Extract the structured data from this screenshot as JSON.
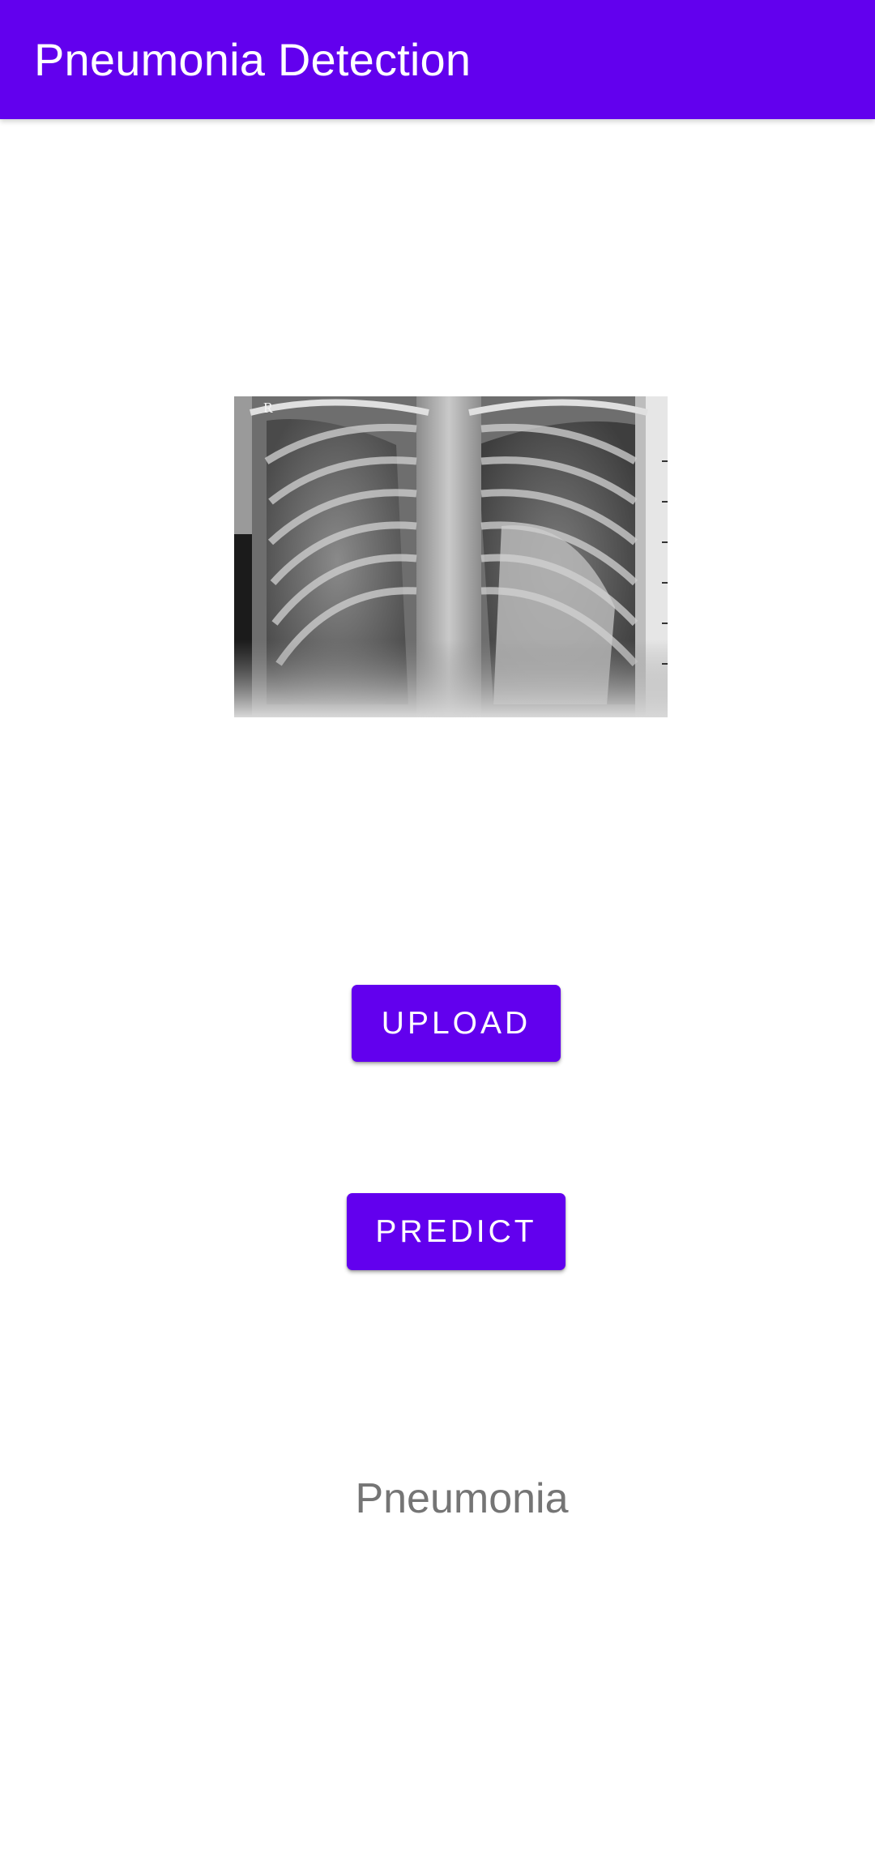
{
  "app_bar": {
    "title": "Pneumonia Detection",
    "color": "#6200ee"
  },
  "preview": {
    "marker_letter": "R"
  },
  "buttons": {
    "upload_label": "UPLOAD",
    "predict_label": "PREDICT"
  },
  "result": {
    "text": "Pneumonia"
  }
}
